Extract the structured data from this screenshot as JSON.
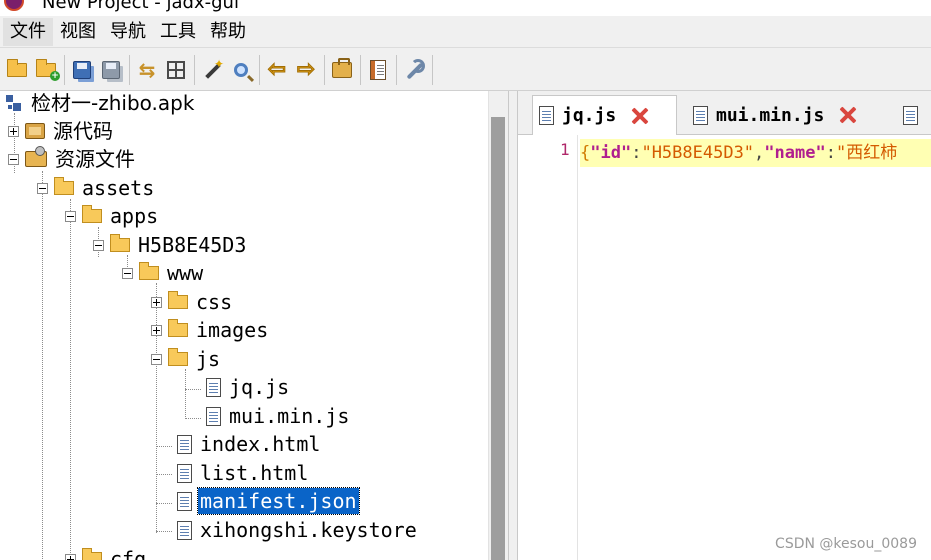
{
  "window": {
    "title": "New Project - jadx-gui"
  },
  "menu": [
    "文件",
    "视图",
    "导航",
    "工具",
    "帮助"
  ],
  "toolbar": {
    "groups": [
      [
        "open-project-icon",
        "add-files-icon"
      ],
      [
        "save-all-icon",
        "export-icon"
      ],
      [
        "sync-tree-icon",
        "flatten-packages-icon"
      ],
      [
        "decompile-all-icon",
        "search-icon"
      ],
      [
        "back-icon",
        "forward-icon"
      ],
      [
        "preferences-icon"
      ],
      [
        "log-viewer-icon"
      ],
      [
        "tools-icon"
      ]
    ]
  },
  "tree": {
    "root": "检材一-zhibo.apk",
    "source_code": "源代码",
    "resources": "资源文件",
    "assets": "assets",
    "apps": "apps",
    "app_id": "H5B8E45D3",
    "www": "www",
    "css": "css",
    "images": "images",
    "js": "js",
    "jq": "jq.js",
    "mui": "mui.min.js",
    "index": "index.html",
    "list": "list.html",
    "manifest": "manifest.json",
    "keystore": "xihongshi.keystore",
    "cfg": "cfg"
  },
  "editor": {
    "tabs": [
      {
        "label": "jq.js",
        "active": true
      },
      {
        "label": "mui.min.js",
        "active": false
      },
      {
        "label": "",
        "active": false
      }
    ],
    "line_number": "1",
    "code": {
      "open": "{",
      "key1": "\"id\"",
      "colon1": ":",
      "val1": "\"H5B8E45D3\"",
      "comma1": ",",
      "key2": "\"name\"",
      "colon2": ":",
      "val2": "\"西红柿"
    }
  },
  "watermark": "CSDN @kesou_0089",
  "colors": {
    "selection": "#0a64c8",
    "current_line": "#ffffb3",
    "close": "#d9463e"
  }
}
